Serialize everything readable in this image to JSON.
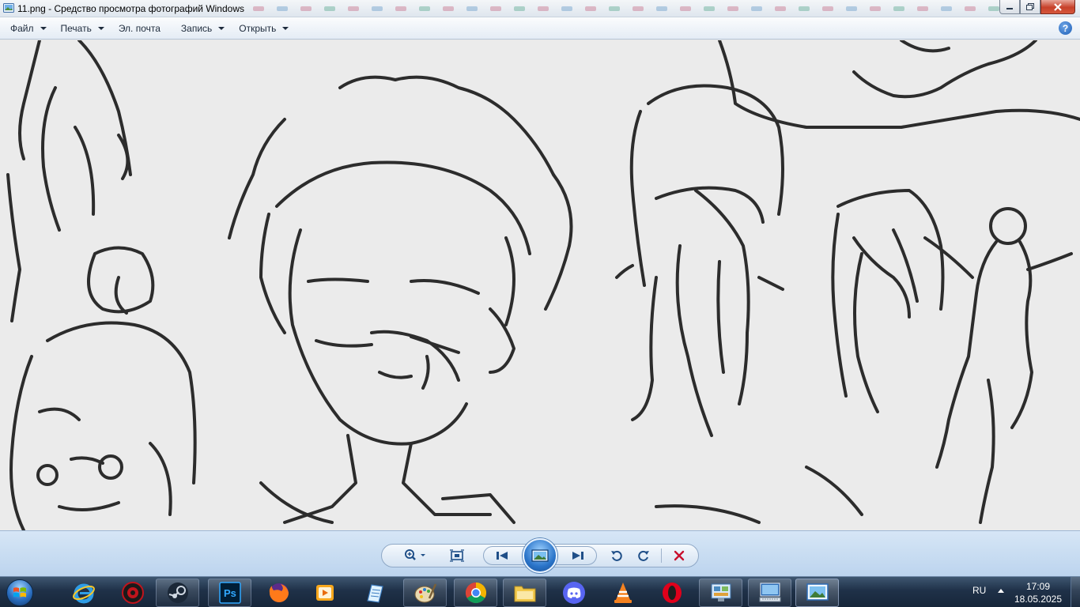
{
  "window": {
    "title": "11.png - Средство просмотра фотографий Windows",
    "controls": [
      "minimize-icon",
      "maximize-icon",
      "close-icon"
    ]
  },
  "menu": {
    "items": [
      {
        "label": "Файл",
        "has_dropdown": true
      },
      {
        "label": "Печать",
        "has_dropdown": true
      },
      {
        "label": "Эл. почта",
        "has_dropdown": false
      },
      {
        "label": "Запись",
        "has_dropdown": true
      },
      {
        "label": "Открыть",
        "has_dropdown": true
      }
    ],
    "help_label": "?"
  },
  "viewer": {
    "image": "pen-sketch-drawing",
    "background_color": "#ececec",
    "ink_color": "#2a2a2a"
  },
  "controls": {
    "buttons": [
      "zoom-icon",
      "actual-size-icon",
      "previous-icon",
      "slideshow-icon",
      "next-icon",
      "rotate-left-icon",
      "rotate-right-icon",
      "delete-icon"
    ],
    "accent": "#2a74c9",
    "delete_color": "#c8102e"
  },
  "taskbar": {
    "pinned": [
      "internet-explorer-icon",
      "game-app-icon",
      "steam-icon",
      "photoshop-icon",
      "firefox-icon",
      "video-app-icon",
      "notes-icon",
      "paint-icon",
      "chrome-icon",
      "file-explorer-icon",
      "discord-icon",
      "vlc-icon",
      "opera-icon",
      "control-panel-icon",
      "remote-desktop-icon",
      "photo-viewer-icon"
    ],
    "language": "RU",
    "time": "17:09",
    "date": "18.05.2025"
  }
}
